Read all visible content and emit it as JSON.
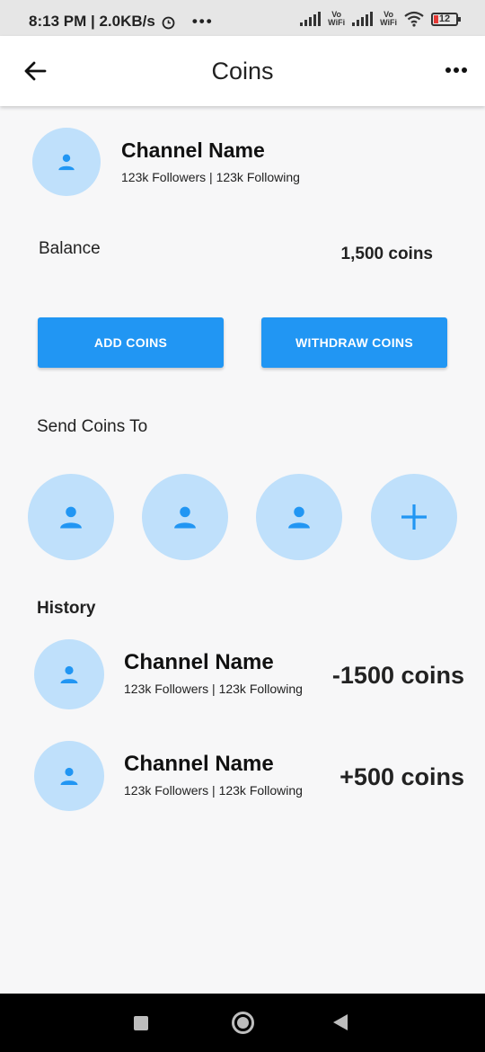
{
  "status": {
    "time_speed": "8:13 PM | 2.0KB/s",
    "battery": "12"
  },
  "appbar": {
    "title": "Coins"
  },
  "profile": {
    "name": "Channel Name",
    "stats": "123k Followers | 123k Following"
  },
  "balance": {
    "label": "Balance",
    "value": "1,500 coins"
  },
  "actions": {
    "add": "ADD COINS",
    "withdraw": "WITHDRAW COINS"
  },
  "send": {
    "title": "Send Coins To"
  },
  "history": {
    "title": "History",
    "items": [
      {
        "name": "Channel Name",
        "stats": "123k Followers | 123k Following",
        "amount": "-1500 coins"
      },
      {
        "name": "Channel Name",
        "stats": "123k Followers | 123k Following",
        "amount": "+500 coins"
      }
    ]
  },
  "colors": {
    "accent": "#2196f3",
    "avatar_bg": "#bfe0fb"
  }
}
